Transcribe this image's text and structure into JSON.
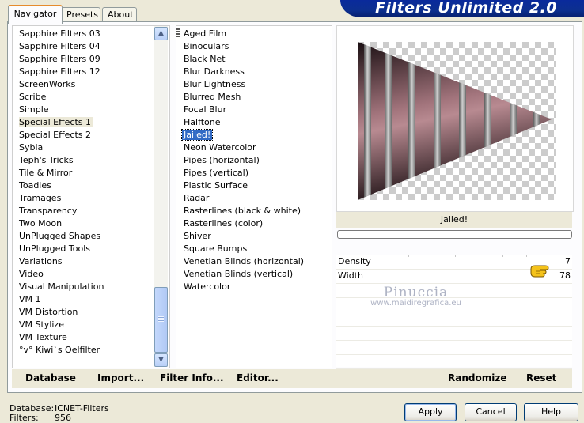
{
  "banner": {
    "title": "Filters Unlimited 2.0"
  },
  "tabs": [
    {
      "label": "Navigator"
    },
    {
      "label": "Presets"
    },
    {
      "label": "About"
    }
  ],
  "categories": {
    "items": [
      "Sapphire Filters 03",
      "Sapphire Filters 04",
      "Sapphire Filters 09",
      "Sapphire Filters 12",
      "ScreenWorks",
      "Scribe",
      "Simple",
      "Special Effects 1",
      "Special Effects 2",
      "Sybia",
      "Teph's Tricks",
      "Tile & Mirror",
      "Toadies",
      "Tramages",
      "Transparency",
      "Two Moon",
      "UnPlugged Shapes",
      "UnPlugged Tools",
      "Variations",
      "Video",
      "Visual Manipulation",
      "VM 1",
      "VM Distortion",
      "VM Stylize",
      "VM Texture",
      "°v° Kiwi`s Oelfilter"
    ],
    "selected": "Special Effects 1",
    "scroll_position": 0.78
  },
  "filters": {
    "items": [
      "Aged Film",
      "Binoculars",
      "Black Net",
      "Blur Darkness",
      "Blur Lightness",
      "Blurred Mesh",
      "Focal Blur",
      "Halftone",
      "Jailed!",
      "Neon Watercolor",
      "Pipes (horizontal)",
      "Pipes (vertical)",
      "Plastic Surface",
      "Radar",
      "Rasterlines (black & white)",
      "Rasterlines (color)",
      "Shiver",
      "Square Bumps",
      "Venetian Blinds (horizontal)",
      "Venetian Blinds (vertical)",
      "Watercolor"
    ],
    "selected": "Jailed!"
  },
  "preview": {
    "filter_name": "Jailed!",
    "progress": 0
  },
  "params": [
    {
      "label": "Density",
      "value": "7"
    },
    {
      "label": "Width",
      "value": "78"
    }
  ],
  "watermark": {
    "name": "Pinuccia",
    "url": "www.maidiregrafica.eu"
  },
  "bottom_buttons": {
    "database": "Database",
    "import": "Import...",
    "filter_info": "Filter Info...",
    "editor": "Editor...",
    "randomize": "Randomize",
    "reset": "Reset"
  },
  "status": {
    "database_label": "Database:",
    "database_value": "ICNET-Filters",
    "filters_label": "Filters:",
    "filters_value": "956"
  },
  "dialog_buttons": {
    "apply": "Apply",
    "cancel": "Cancel",
    "help": "Help"
  },
  "colors": {
    "banner": "#0c2f8f",
    "selection": "#316ac5",
    "tab_accent": "#e68b2c"
  },
  "icons": {
    "scroll_up": "chevron-up-icon",
    "scroll_down": "chevron-down-icon",
    "pointer": "pointing-hand-icon"
  }
}
